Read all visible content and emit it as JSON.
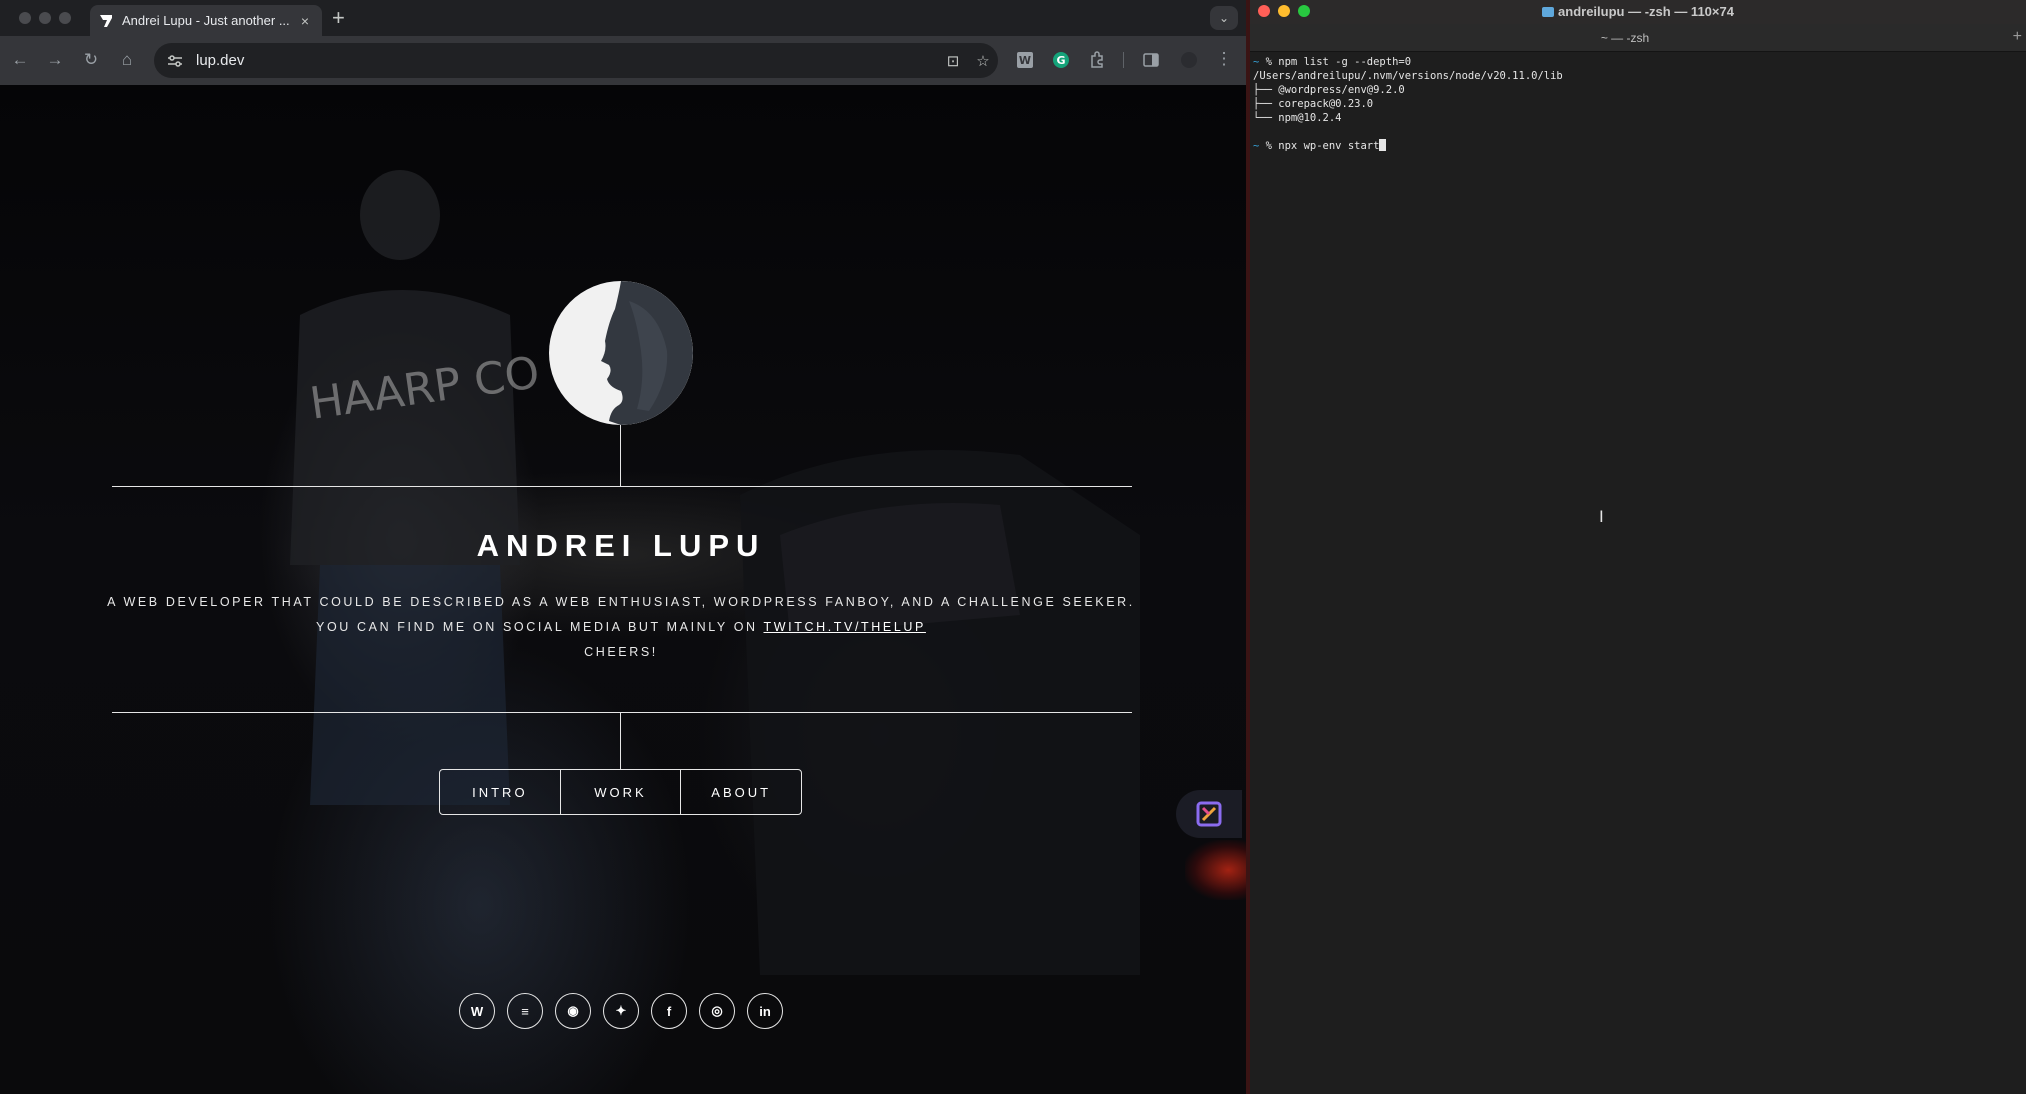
{
  "browser": {
    "tab": {
      "title": "Andrei Lupu - Just another ...",
      "close": "×"
    },
    "new_tab": "+",
    "tab_menu": "⌄",
    "nav": {
      "back": "←",
      "forward": "→",
      "reload": "↻",
      "home": "⌂"
    },
    "address": {
      "url": "lup.dev"
    },
    "omnibox_icons": {
      "install": "⊡",
      "bookmark": "☆"
    },
    "menu": "⋮"
  },
  "site": {
    "name": "ANDREI LUPU",
    "tagline": "A WEB DEVELOPER THAT COULD BE DESCRIBED AS A WEB ENTHUSIAST, WORDPRESS FANBOY, AND A CHALLENGE SEEKER.",
    "social_prefix": "YOU CAN FIND ME ON SOCIAL MEDIA BUT MAINLY ON",
    "social_link": "TWITCH.TV/THELUP",
    "signoff": "CHEERS!",
    "nav": [
      "INTRO",
      "WORK",
      "ABOUT"
    ],
    "socials": [
      {
        "name": "wordpress",
        "glyph": "W"
      },
      {
        "name": "stackoverflow",
        "glyph": "≡"
      },
      {
        "name": "github",
        "glyph": "◉"
      },
      {
        "name": "twitter",
        "glyph": "✦"
      },
      {
        "name": "facebook",
        "glyph": "f"
      },
      {
        "name": "instagram",
        "glyph": "◎"
      },
      {
        "name": "linkedin",
        "glyph": "in"
      }
    ],
    "photo_jacket_text": "HAARP CORE"
  },
  "terminal": {
    "title": "andreilupu — -zsh — 110×74",
    "tab": "~ — -zsh",
    "plus": "+",
    "lines": [
      {
        "prompt": "~",
        "text": " % npm list -g --depth=0"
      },
      {
        "prompt": "",
        "text": "/Users/andreilupu/.nvm/versions/node/v20.11.0/lib"
      },
      {
        "prompt": "",
        "text": "├── @wordpress/env@9.2.0"
      },
      {
        "prompt": "",
        "text": "├── corepack@0.23.0"
      },
      {
        "prompt": "",
        "text": "└── npm@10.2.4"
      },
      {
        "prompt": "",
        "text": ""
      },
      {
        "prompt": "~",
        "text": " % npx wp-env start"
      }
    ]
  },
  "colors": {
    "chrome_tabstrip": "#1f2023",
    "chrome_toolbar": "#35363a",
    "terminal_bg": "#1e1e1e",
    "prompt_arrow": "#36a3d9",
    "traffic_red": "#ff5f57",
    "traffic_yellow": "#febc2e",
    "traffic_green": "#28c840"
  }
}
